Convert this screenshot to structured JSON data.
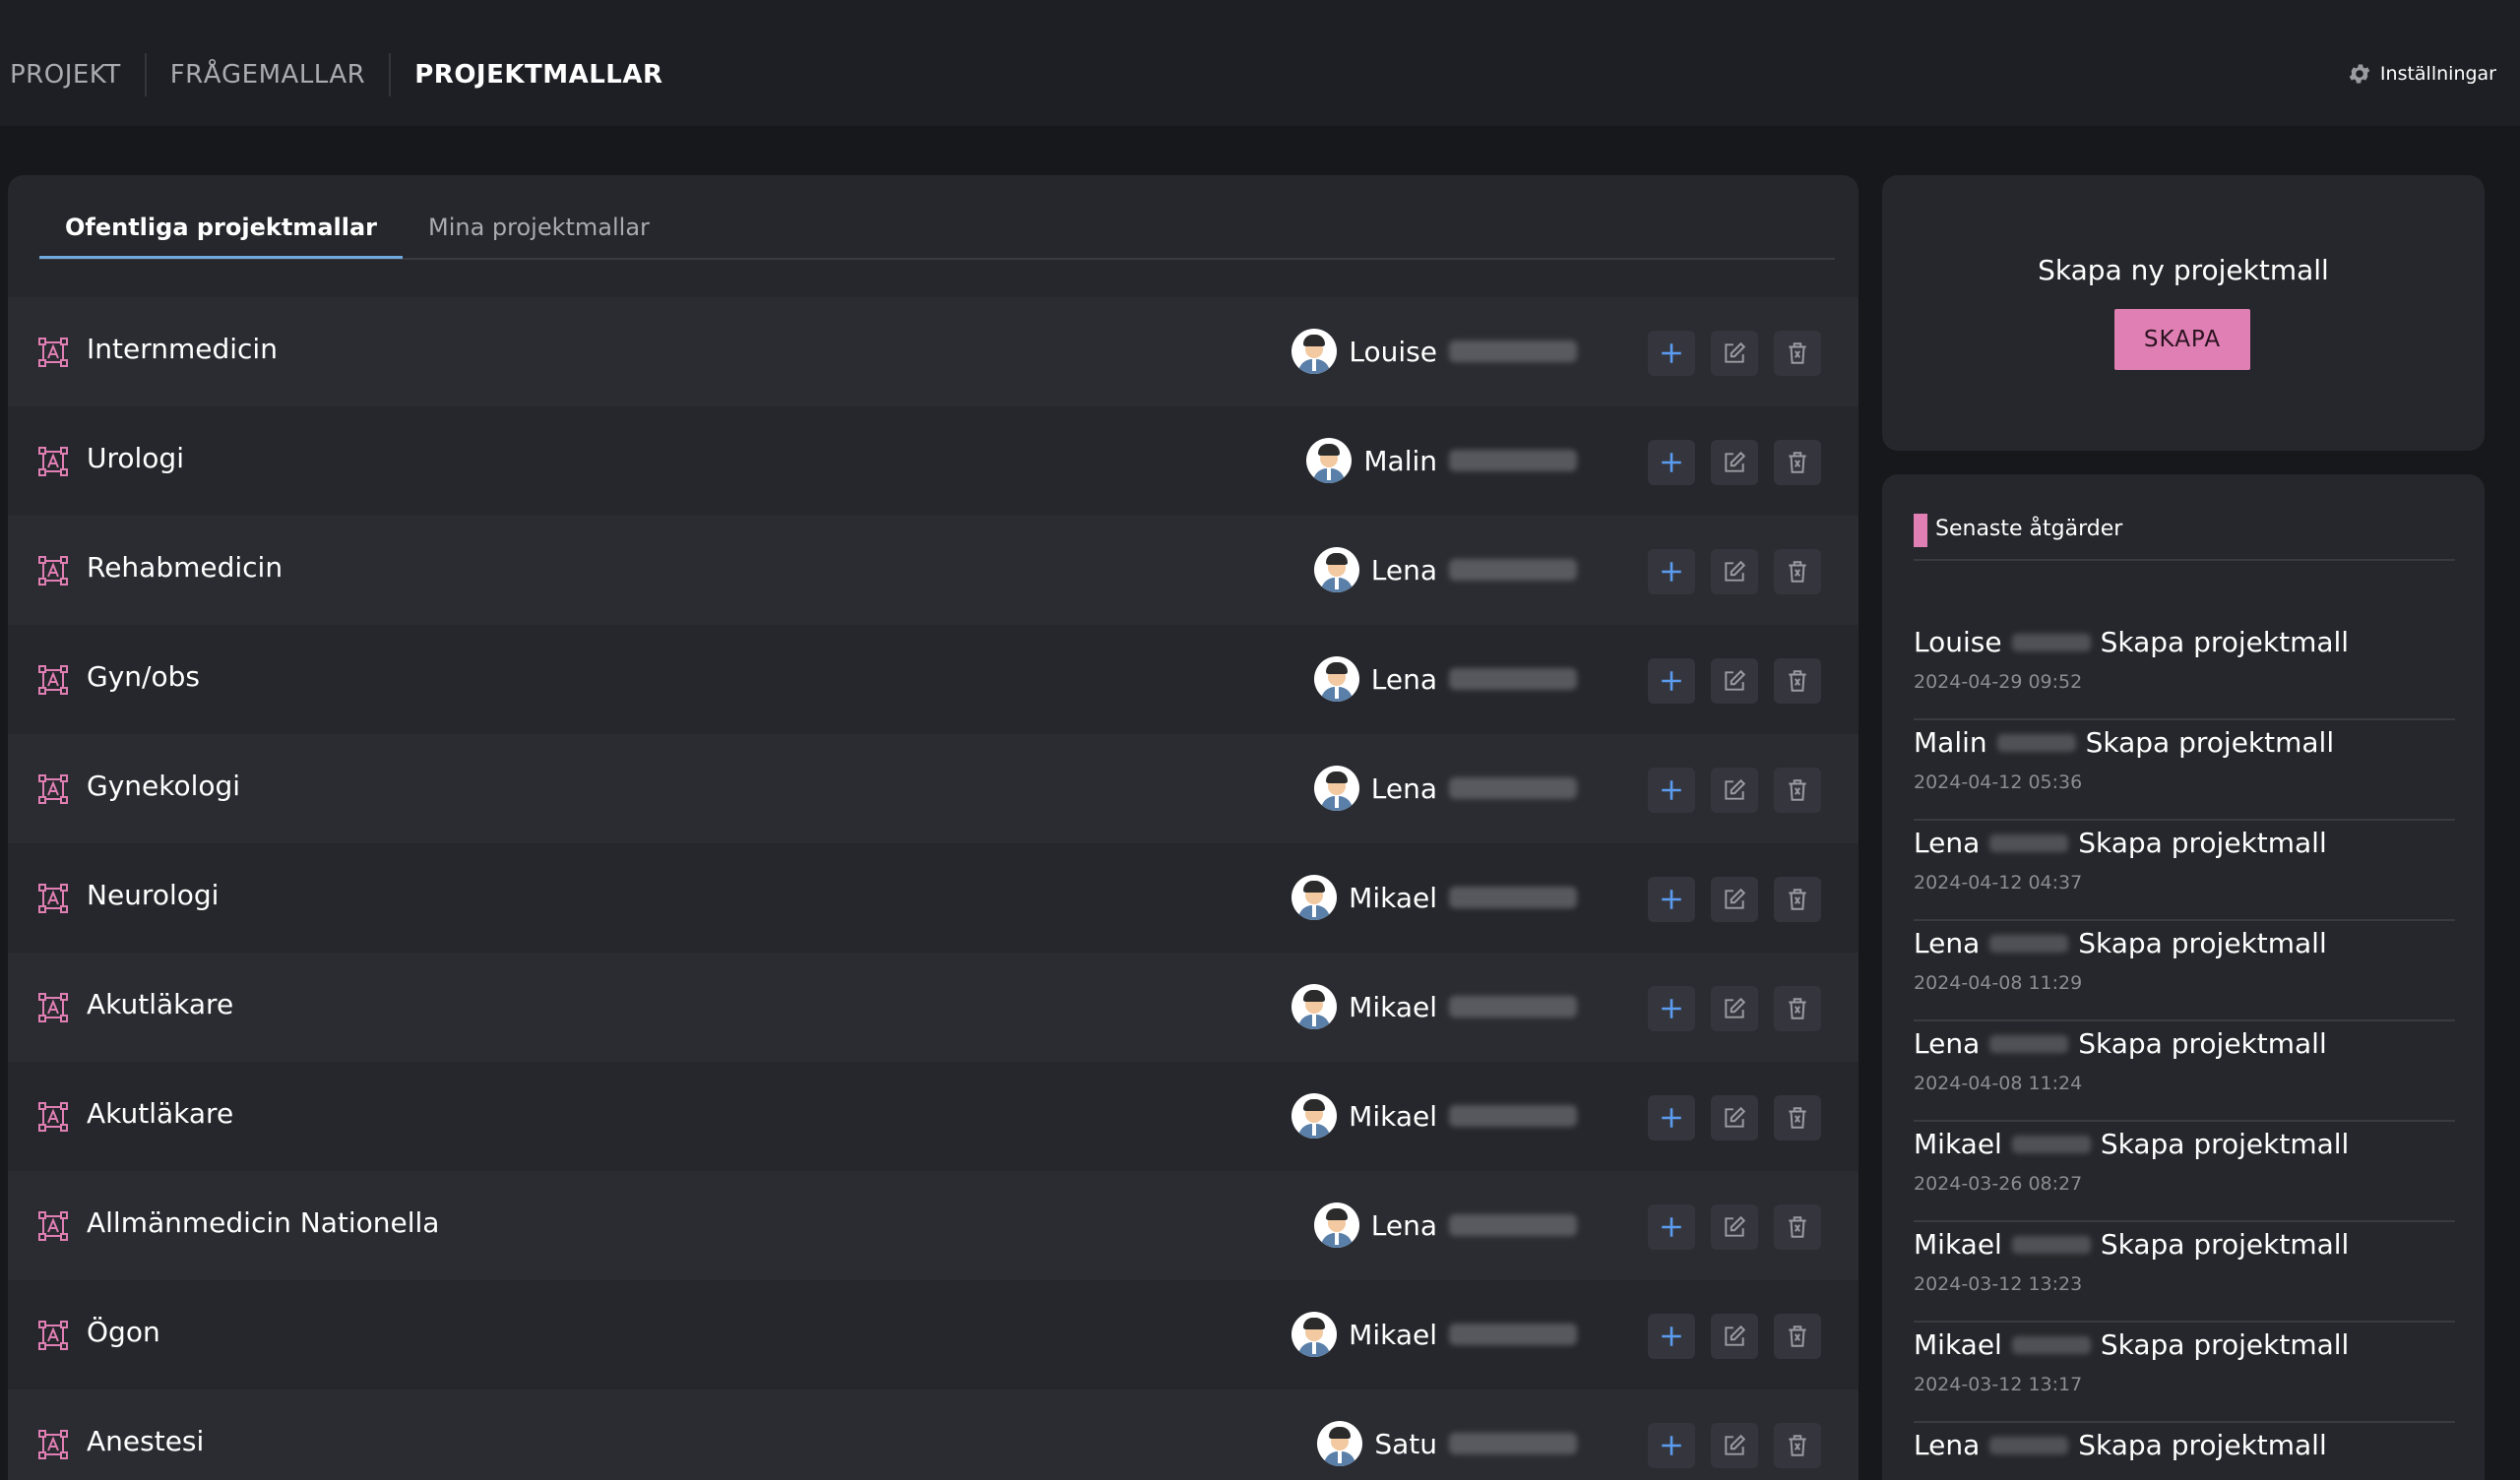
{
  "nav": {
    "items": [
      "PROJEKT",
      "FRÅGEMALLAR",
      "PROJEKTMALLAR"
    ],
    "active_index": 2,
    "settings_label": "Inställningar",
    "settings_icon": "gear-icon"
  },
  "main": {
    "tabs": [
      "Ofentliga projektmallar",
      "Mina projektmallar"
    ],
    "active_tab": 0,
    "rows": [
      {
        "name": "Internmedicin",
        "owner": "Louise"
      },
      {
        "name": "Urologi",
        "owner": "Malin"
      },
      {
        "name": "Rehabmedicin",
        "owner": "Lena"
      },
      {
        "name": "Gyn/obs",
        "owner": "Lena"
      },
      {
        "name": "Gynekologi",
        "owner": "Lena"
      },
      {
        "name": "Neurologi",
        "owner": "Mikael"
      },
      {
        "name": "Akutläkare",
        "owner": "Mikael"
      },
      {
        "name": "Akutläkare",
        "owner": "Mikael"
      },
      {
        "name": "Allmänmedicin Nationella",
        "owner": "Lena"
      },
      {
        "name": "Ögon",
        "owner": "Mikael"
      },
      {
        "name": "Anestesi",
        "owner": "Satu"
      }
    ]
  },
  "create": {
    "title": "Skapa ny projektmall",
    "button_label": "SKAPA"
  },
  "recent": {
    "title": "Senaste åtgärder",
    "items": [
      {
        "user": "Louise",
        "action": "Skapa projektmall",
        "time": "2024-04-29 09:52"
      },
      {
        "user": "Malin",
        "action": "Skapa projektmall",
        "time": "2024-04-12 05:36"
      },
      {
        "user": "Lena",
        "action": "Skapa projektmall",
        "time": "2024-04-12 04:37"
      },
      {
        "user": "Lena",
        "action": "Skapa projektmall",
        "time": "2024-04-08 11:29"
      },
      {
        "user": "Lena",
        "action": "Skapa projektmall",
        "time": "2024-04-08 11:24"
      },
      {
        "user": "Mikael",
        "action": "Skapa projektmall",
        "time": "2024-03-26 08:27"
      },
      {
        "user": "Mikael",
        "action": "Skapa projektmall",
        "time": "2024-03-12 13:23"
      },
      {
        "user": "Mikael",
        "action": "Skapa projektmall",
        "time": "2024-03-12 13:17"
      },
      {
        "user": "Lena",
        "action": "Skapa projektmall",
        "time": ""
      }
    ]
  },
  "colors": {
    "accent_pink": "#e07fb3",
    "tab_underline": "#6fa8dc",
    "plus_blue": "#5b9cf0"
  }
}
